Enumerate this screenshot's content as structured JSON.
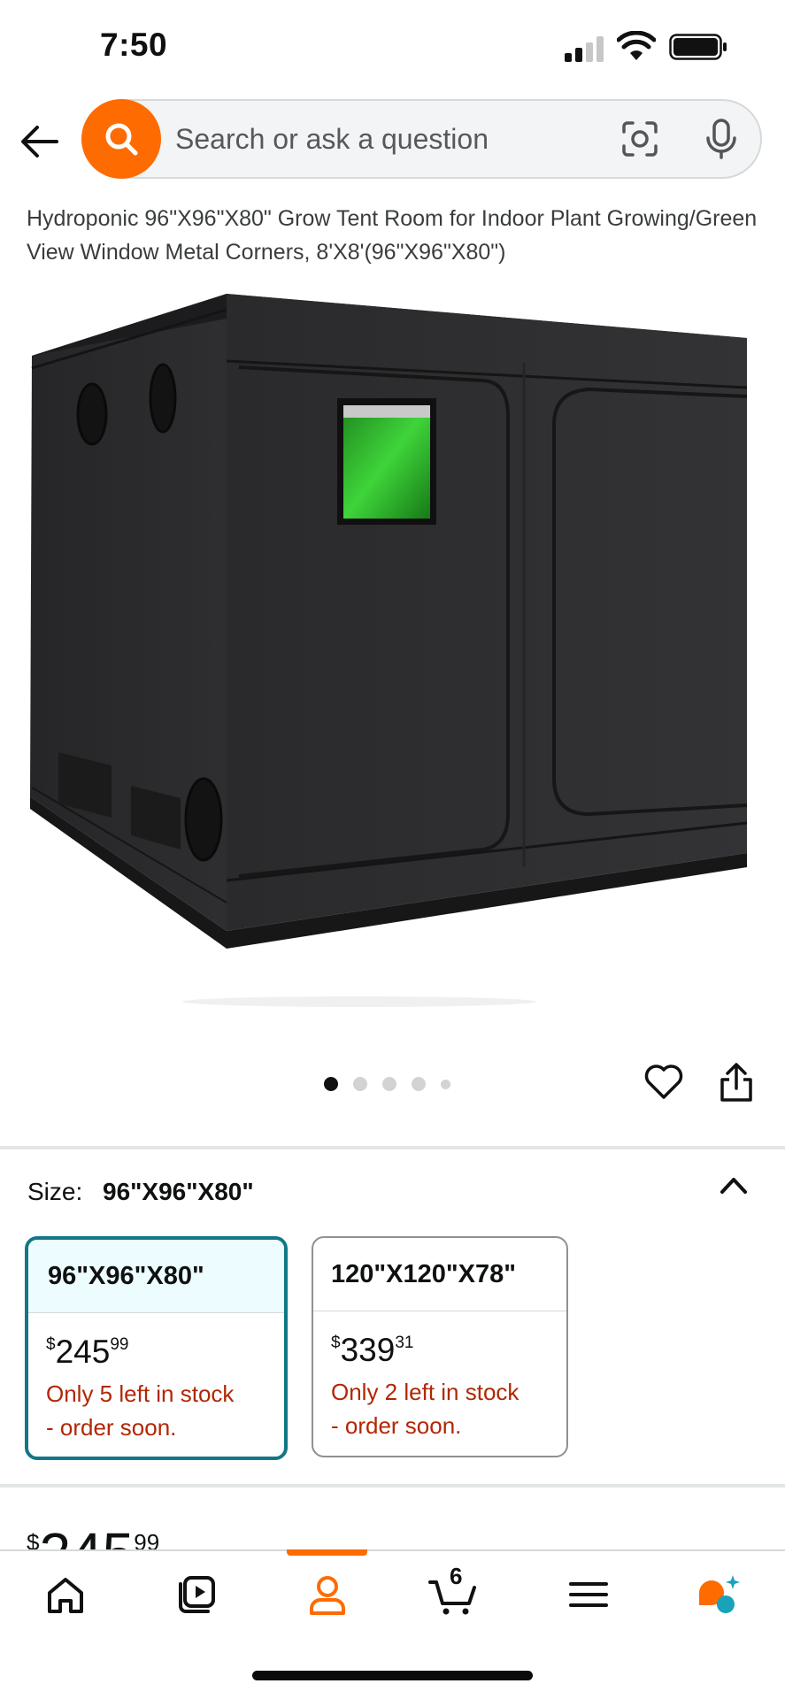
{
  "status_bar": {
    "time": "7:50"
  },
  "search": {
    "placeholder": "Search or ask a question"
  },
  "product": {
    "title": "Hydroponic 96\"X96\"X80\" Grow Tent Room for Indoor Plant Growing/Green View Window Metal Corners, 8'X8'(96\"X96\"X80\")",
    "image_alt": "Black grow tent with green view window",
    "carousel_dot_count": 5,
    "carousel_active_index": 0
  },
  "size_selector": {
    "label": "Size:",
    "selected_value": "96\"X96\"X80\"",
    "options": [
      {
        "name": "96\"X96\"X80\"",
        "price_currency": "$",
        "price_whole": "245",
        "price_fraction": "99",
        "stock_line1": "Only 5 left in stock",
        "stock_line2": "- order soon.",
        "selected": true
      },
      {
        "name": "120\"X120\"X78\"",
        "price_currency": "$",
        "price_whole": "339",
        "price_fraction": "31",
        "stock_line1": "Only 2 left in stock",
        "stock_line2": "- order soon.",
        "selected": false
      }
    ]
  },
  "price": {
    "currency": "$",
    "whole": "245",
    "fraction": "99"
  },
  "bottom_nav": {
    "cart_count": "6",
    "items": [
      "home-icon",
      "video-icon",
      "account-icon",
      "cart-icon",
      "menu-icon",
      "rufus-icon"
    ],
    "active_item": "account-icon"
  },
  "colors": {
    "accent_orange": "#fe6b00",
    "selected_border": "#127786",
    "stock_red": "#b12704"
  }
}
